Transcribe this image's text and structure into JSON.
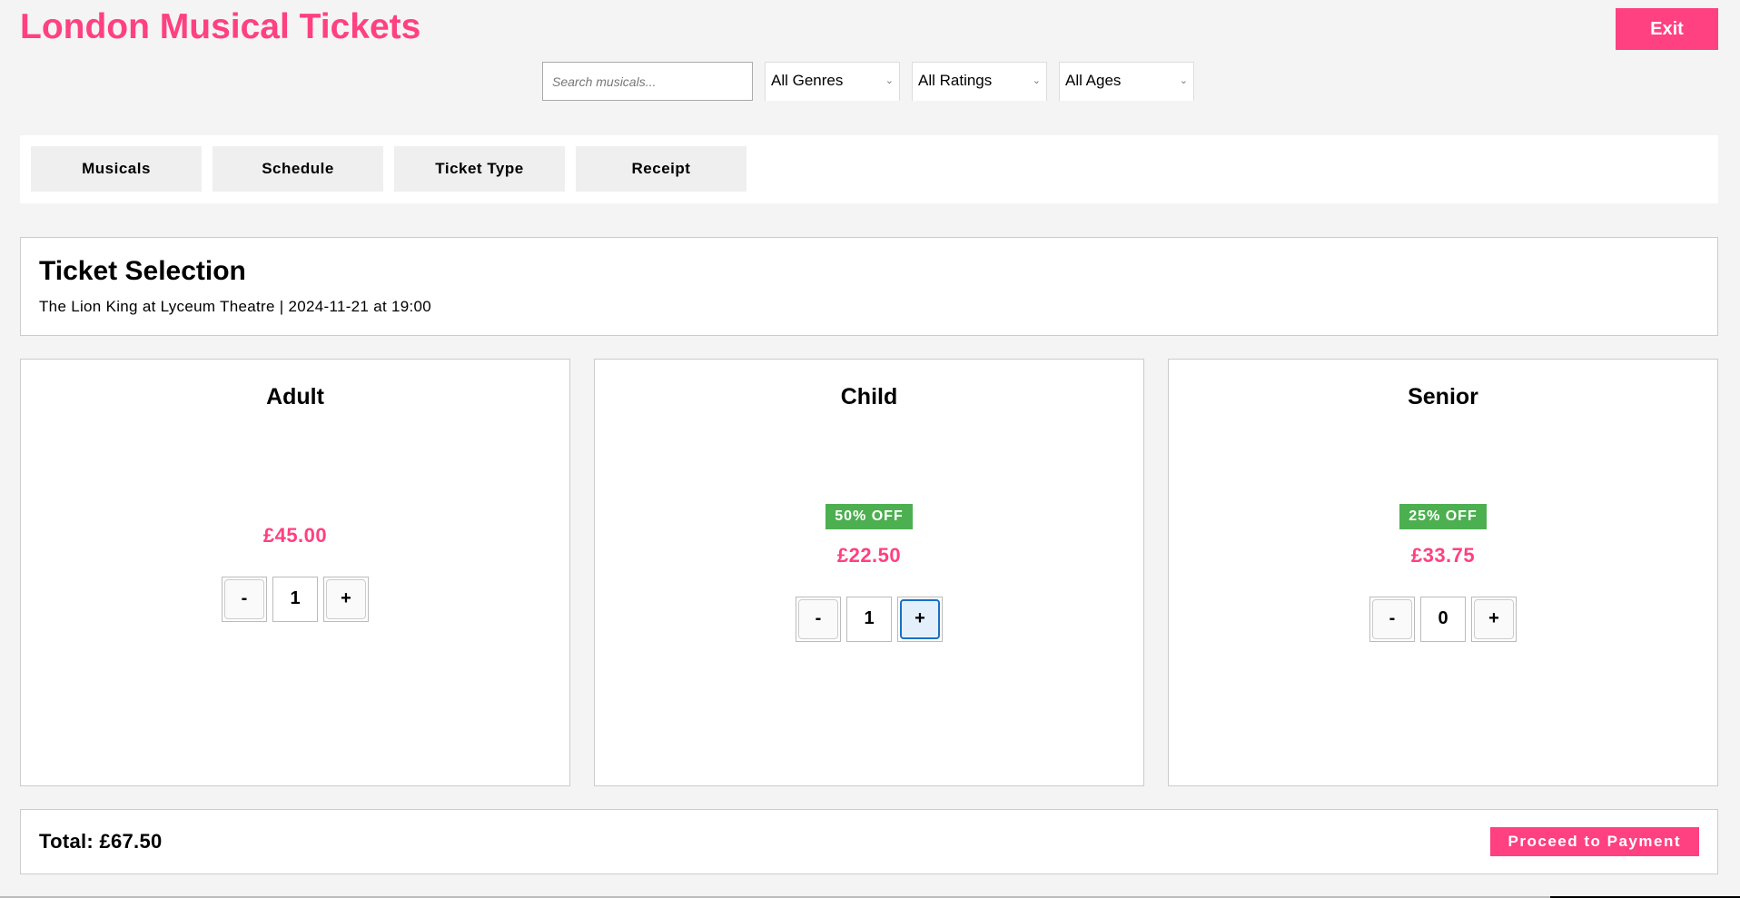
{
  "header": {
    "title": "London Musical Tickets",
    "exit_label": "Exit"
  },
  "filters": {
    "search_placeholder": "Search musicals...",
    "search_value": "",
    "genre": "All Genres",
    "rating": "All Ratings",
    "age": "All Ages",
    "chevron_icon": "⌄"
  },
  "tabs": [
    {
      "label": "Musicals"
    },
    {
      "label": "Schedule"
    },
    {
      "label": "Ticket Type"
    },
    {
      "label": "Receipt"
    }
  ],
  "selection": {
    "title": "Ticket Selection",
    "subtitle": "The Lion King at Lyceum Theatre | 2024-11-21 at 19:00"
  },
  "tickets": [
    {
      "type": "Adult",
      "discount": "",
      "price": "£45.00",
      "quantity": "1",
      "minus": "-",
      "plus": "+"
    },
    {
      "type": "Child",
      "discount": "50% OFF",
      "price": "£22.50",
      "quantity": "1",
      "minus": "-",
      "plus": "+"
    },
    {
      "type": "Senior",
      "discount": "25% OFF",
      "price": "£33.75",
      "quantity": "0",
      "minus": "-",
      "plus": "+"
    }
  ],
  "footer": {
    "total": "Total: £67.50",
    "proceed_label": "Proceed to Payment"
  },
  "colors": {
    "accent": "#ff4081",
    "discount": "#4caf50",
    "background": "#f4f4f4"
  }
}
